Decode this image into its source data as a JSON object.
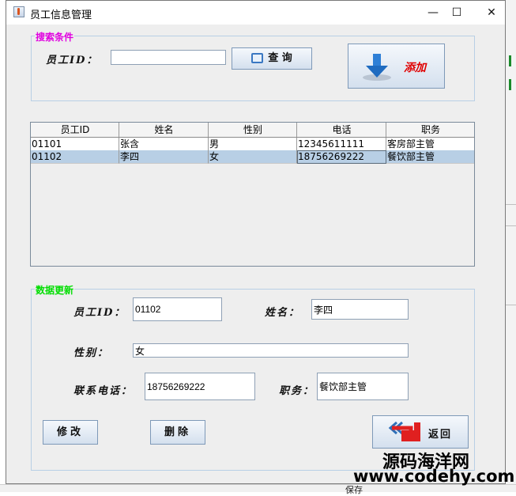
{
  "window": {
    "title": "员工信息管理",
    "minimize": "—",
    "maximize": "☐",
    "close": "✕"
  },
  "search": {
    "legend": "搜索条件",
    "id_label": "员工ID：",
    "id_value": "",
    "query_button": "查  询",
    "add_button": "添加"
  },
  "table": {
    "headers": [
      "员工ID",
      "姓名",
      "性别",
      "电话",
      "职务"
    ],
    "rows": [
      [
        "01101",
        "张含",
        "男",
        "12345611111",
        "客房部主管"
      ],
      [
        "01102",
        "李四",
        "女",
        "18756269222",
        "餐饮部主管"
      ]
    ],
    "selected_row": 1
  },
  "update": {
    "legend": "数据更新",
    "id_label": "员工ID：",
    "id_value": "01102",
    "name_label": "姓名：",
    "name_value": "李四",
    "gender_label": "性别：",
    "gender_value": "女",
    "phone_label": "联系电话：",
    "phone_value": "18756269222",
    "job_label": "职务：",
    "job_value": "餐饮部主管",
    "modify_button": "修改",
    "delete_button": "删除",
    "back_button": "返回"
  },
  "background": {
    "bottom_text": "保存"
  },
  "watermark": {
    "line1": "源码海洋网",
    "line2": "www.codehy.com"
  },
  "colors": {
    "legend_search": "#e000e0",
    "legend_update": "#00dd00",
    "add_text": "#e00000",
    "selected_row": "#b8cfe5"
  }
}
